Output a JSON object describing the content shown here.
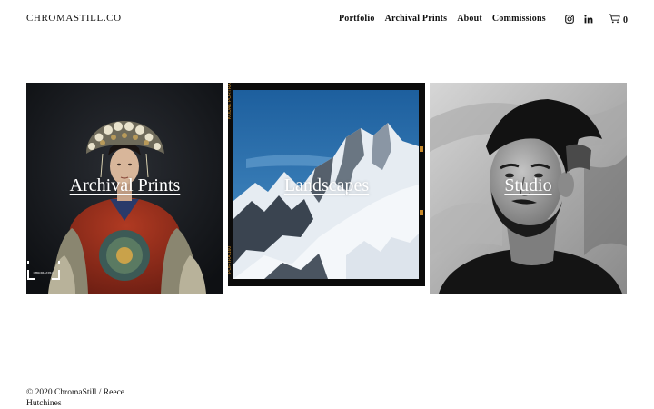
{
  "header": {
    "brand": "CHROMASTILL.CO",
    "nav": [
      "Portfolio",
      "Archival Prints",
      "About",
      "Commissions"
    ],
    "social_icons": [
      "instagram-icon",
      "linkedin-icon"
    ],
    "cart_icon": "cart-icon",
    "cart_count": "0"
  },
  "gallery": [
    {
      "title": "Archival Prints"
    },
    {
      "title": "Landscapes"
    },
    {
      "title": "Studio"
    }
  ],
  "watermark": {
    "brand": "CHROMASTILL"
  },
  "footer": {
    "copyright": "© 2020 ChromaStill / Reece Hutchines"
  },
  "colors": {
    "text": "#111111",
    "background": "#ffffff"
  }
}
